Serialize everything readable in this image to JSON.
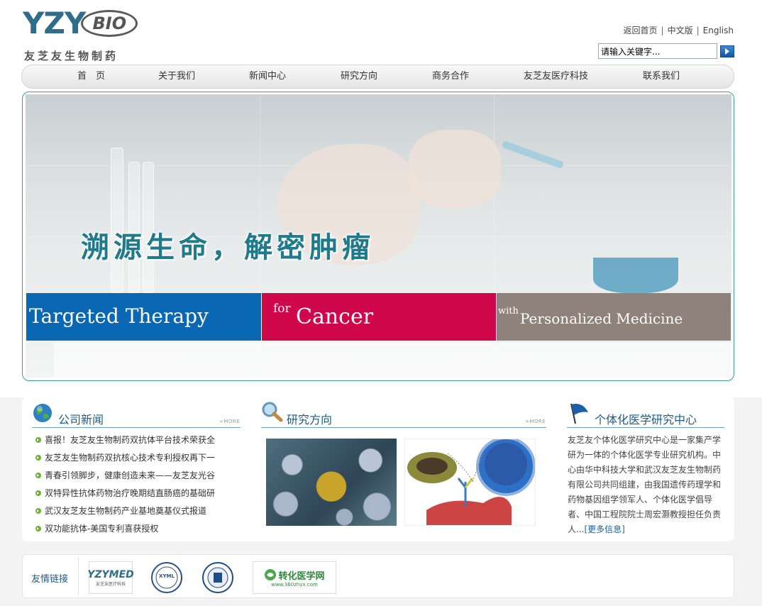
{
  "brand": {
    "logo_main": "YZY",
    "logo_sub": "BIO",
    "logo_cn": "友芝友生物制药"
  },
  "top_links": [
    "返回首页",
    "中文版",
    "English"
  ],
  "search": {
    "value": "请输入关键字..."
  },
  "nav": [
    "首　页",
    "关于我们",
    "新闻中心",
    "研究方向",
    "商务合作",
    "友芝友医疗科技",
    "联系我们"
  ],
  "banner": {
    "slogan": "溯源生命，解密肿瘤",
    "strip1": "Targeted Therapy",
    "strip2_small": "for",
    "strip2_big": "Cancer",
    "strip3_small": "with",
    "strip3_big": "Personalized Medicine"
  },
  "news": {
    "title": "公司新闻",
    "more": "+MORE",
    "items": [
      "喜报！友芝友生物制药双抗体平台技术荣获全",
      "友芝友生物制药双抗核心技术专利授权再下一",
      "青春引领脚步，健康创造未来——友芝友光谷",
      "双特异性抗体药物治疗晚期结直肠癌的基础研",
      "武汉友芝友生物制药产业基地奠基仪式报道",
      "双功能抗体-美国专利喜获授权"
    ]
  },
  "research": {
    "title": "研究方向",
    "more": "+MORE"
  },
  "center": {
    "title": "个体化医学研究中心",
    "desc": "友芝友个体化医学研究中心是一家集产学研为一体的个体化医学专业研究机构。中心由华中科技大学和武汉友芝友生物制药有限公司共同组建，由我国遗传药理学和药物基因组学领军人、个体化医学倡导者、中国工程院院士周宏灏教授担任负责人...",
    "more": "[更多信息]"
  },
  "links": {
    "label": "友情链接",
    "items": [
      {
        "name": "YZYMED",
        "sub": "友芝友医疗科技"
      },
      {
        "name": "XYML",
        "sub": ""
      },
      {
        "name": "",
        "sub": ""
      },
      {
        "name": "转化医学网",
        "sub": "www.360zhyx.com"
      }
    ]
  },
  "colors": {
    "accent": "#1d5c8c",
    "strip_blue": "#0a67b3",
    "strip_red": "#d0074a",
    "strip_grey": "#8f827a"
  }
}
